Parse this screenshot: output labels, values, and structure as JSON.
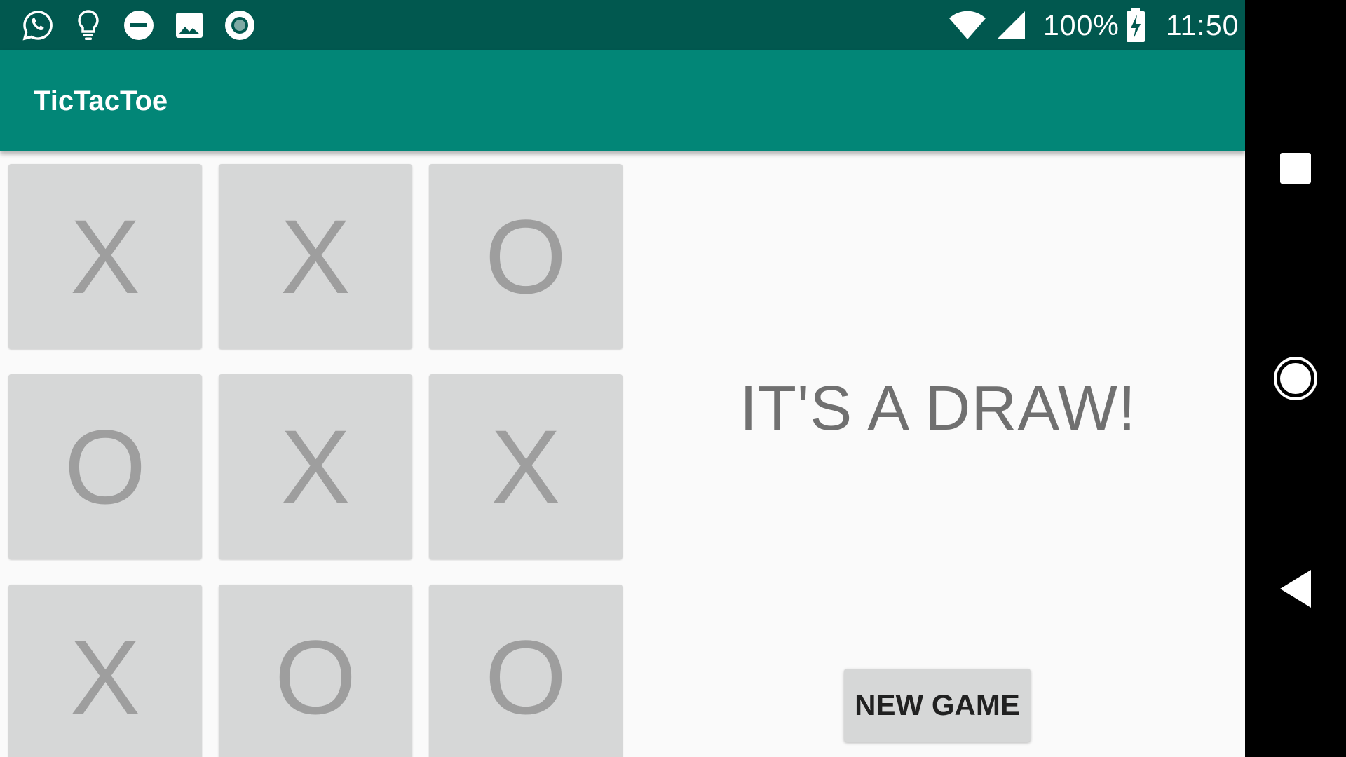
{
  "status_bar": {
    "left_icons": [
      "whatsapp-icon",
      "lightbulb-icon",
      "do-not-disturb-icon",
      "image-icon",
      "record-icon"
    ],
    "battery_percent": "100%",
    "time": "11:50"
  },
  "app_bar": {
    "title": "TicTacToe"
  },
  "board": {
    "cells": [
      "X",
      "X",
      "O",
      "O",
      "X",
      "X",
      "X",
      "O",
      "O"
    ]
  },
  "game": {
    "status_message": "IT'S A DRAW!",
    "new_game_label": "NEW GAME"
  },
  "nav_bar": {
    "buttons": [
      "recents-square-icon",
      "home-circle-icon",
      "back-triangle-icon"
    ]
  },
  "colors": {
    "status_bar": "#01584F",
    "app_bar": "#028677",
    "cell_background": "#D6D7D7",
    "cell_mark": "#9E9E9E",
    "background": "#FAFAFA"
  }
}
